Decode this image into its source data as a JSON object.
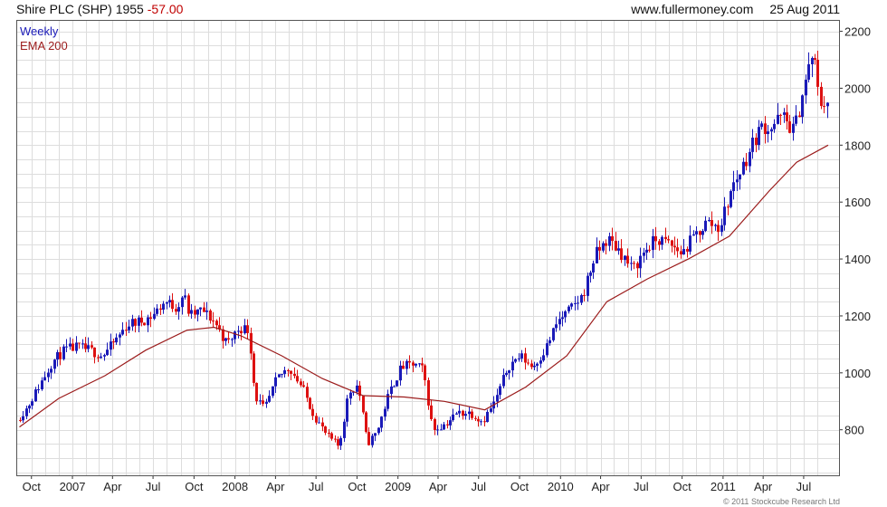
{
  "header": {
    "title": "Shire PLC (SHP)",
    "price": "1955",
    "change": "-57.00",
    "site": "www.fullermoney.com",
    "date": "25 Aug 2011"
  },
  "legend": {
    "weekly": "Weekly",
    "ema": "EMA 200"
  },
  "copyright": "© 2011 Stockcube Research Ltd",
  "colors": {
    "up_candle": "#1a1ab8",
    "down_candle": "#dd1111",
    "ema_line": "#9b1b1b",
    "grid": "#dddddd"
  },
  "chart_data": {
    "type": "candlestick",
    "frequency": "weekly",
    "x_range": [
      "2006-09-01",
      "2011-08-25"
    ],
    "ylim": [
      640,
      2240
    ],
    "y_ticks": [
      800,
      1000,
      1200,
      1400,
      1600,
      1800,
      2000,
      2200
    ],
    "x_ticks": [
      {
        "date": "2006-10-01",
        "label": "Oct"
      },
      {
        "date": "2007-01-01",
        "label": "2007"
      },
      {
        "date": "2007-04-01",
        "label": "Apr"
      },
      {
        "date": "2007-07-01",
        "label": "Jul"
      },
      {
        "date": "2007-10-01",
        "label": "Oct"
      },
      {
        "date": "2008-01-01",
        "label": "2008"
      },
      {
        "date": "2008-04-01",
        "label": "Apr"
      },
      {
        "date": "2008-07-01",
        "label": "Jul"
      },
      {
        "date": "2008-10-01",
        "label": "Oct"
      },
      {
        "date": "2009-01-01",
        "label": "2009"
      },
      {
        "date": "2009-04-01",
        "label": "Apr"
      },
      {
        "date": "2009-07-01",
        "label": "Jul"
      },
      {
        "date": "2009-10-01",
        "label": "Oct"
      },
      {
        "date": "2010-01-01",
        "label": "2010"
      },
      {
        "date": "2010-04-01",
        "label": "Apr"
      },
      {
        "date": "2010-07-01",
        "label": "Jul"
      },
      {
        "date": "2010-10-01",
        "label": "Oct"
      },
      {
        "date": "2011-01-01",
        "label": "2011"
      },
      {
        "date": "2011-04-01",
        "label": "Apr"
      },
      {
        "date": "2011-07-01",
        "label": "Jul"
      }
    ],
    "price_path": [
      [
        "2006-09-04",
        840
      ],
      [
        "2006-09-25",
        880
      ],
      [
        "2006-10-23",
        960
      ],
      [
        "2006-11-20",
        1040
      ],
      [
        "2006-12-18",
        1080
      ],
      [
        "2007-01-15",
        1090
      ],
      [
        "2007-02-12",
        1080
      ],
      [
        "2007-03-12",
        1060
      ],
      [
        "2007-04-09",
        1110
      ],
      [
        "2007-05-07",
        1170
      ],
      [
        "2007-06-04",
        1180
      ],
      [
        "2007-07-02",
        1200
      ],
      [
        "2007-07-30",
        1250
      ],
      [
        "2007-08-27",
        1230
      ],
      [
        "2007-09-10",
        1280
      ],
      [
        "2007-09-24",
        1200
      ],
      [
        "2007-10-22",
        1220
      ],
      [
        "2007-11-19",
        1180
      ],
      [
        "2007-12-17",
        1100
      ],
      [
        "2008-01-14",
        1160
      ],
      [
        "2008-02-04",
        1150
      ],
      [
        "2008-02-18",
        920
      ],
      [
        "2008-03-10",
        870
      ],
      [
        "2008-04-07",
        980
      ],
      [
        "2008-05-05",
        1020
      ],
      [
        "2008-06-02",
        950
      ],
      [
        "2008-06-30",
        850
      ],
      [
        "2008-07-28",
        780
      ],
      [
        "2008-08-25",
        740
      ],
      [
        "2008-09-15",
        930
      ],
      [
        "2008-10-06",
        960
      ],
      [
        "2008-10-27",
        750
      ],
      [
        "2008-11-17",
        790
      ],
      [
        "2008-12-15",
        930
      ],
      [
        "2009-01-12",
        1020
      ],
      [
        "2009-02-09",
        1030
      ],
      [
        "2009-03-02",
        1010
      ],
      [
        "2009-03-23",
        800
      ],
      [
        "2009-04-20",
        820
      ],
      [
        "2009-05-18",
        860
      ],
      [
        "2009-06-15",
        860
      ],
      [
        "2009-07-13",
        830
      ],
      [
        "2009-08-10",
        900
      ],
      [
        "2009-09-07",
        1020
      ],
      [
        "2009-10-05",
        1060
      ],
      [
        "2009-11-02",
        1020
      ],
      [
        "2009-11-30",
        1080
      ],
      [
        "2009-12-28",
        1180
      ],
      [
        "2010-01-25",
        1220
      ],
      [
        "2010-02-22",
        1270
      ],
      [
        "2010-03-22",
        1410
      ],
      [
        "2010-04-19",
        1470
      ],
      [
        "2010-05-17",
        1430
      ],
      [
        "2010-06-14",
        1360
      ],
      [
        "2010-07-12",
        1430
      ],
      [
        "2010-08-09",
        1470
      ],
      [
        "2010-09-06",
        1450
      ],
      [
        "2010-10-04",
        1420
      ],
      [
        "2010-11-01",
        1480
      ],
      [
        "2010-11-29",
        1530
      ],
      [
        "2010-12-27",
        1510
      ],
      [
        "2011-01-24",
        1650
      ],
      [
        "2011-02-21",
        1740
      ],
      [
        "2011-03-21",
        1840
      ],
      [
        "2011-04-04",
        1870
      ],
      [
        "2011-04-18",
        1860
      ],
      [
        "2011-05-16",
        1900
      ],
      [
        "2011-06-13",
        1850
      ],
      [
        "2011-07-04",
        2000
      ],
      [
        "2011-07-25",
        2130
      ],
      [
        "2011-08-08",
        1950
      ],
      [
        "2011-08-25",
        1955
      ]
    ],
    "ema_200": [
      [
        "2006-09-04",
        810
      ],
      [
        "2006-12-01",
        910
      ],
      [
        "2007-03-15",
        990
      ],
      [
        "2007-06-15",
        1080
      ],
      [
        "2007-09-15",
        1150
      ],
      [
        "2007-11-15",
        1160
      ],
      [
        "2008-01-15",
        1130
      ],
      [
        "2008-04-15",
        1060
      ],
      [
        "2008-07-15",
        980
      ],
      [
        "2008-10-15",
        920
      ],
      [
        "2009-01-15",
        915
      ],
      [
        "2009-04-15",
        900
      ],
      [
        "2009-07-15",
        870
      ],
      [
        "2009-10-15",
        950
      ],
      [
        "2010-01-15",
        1060
      ],
      [
        "2010-04-15",
        1250
      ],
      [
        "2010-07-15",
        1330
      ],
      [
        "2010-10-15",
        1400
      ],
      [
        "2011-01-15",
        1480
      ],
      [
        "2011-04-15",
        1640
      ],
      [
        "2011-06-15",
        1740
      ],
      [
        "2011-08-25",
        1800
      ]
    ]
  }
}
